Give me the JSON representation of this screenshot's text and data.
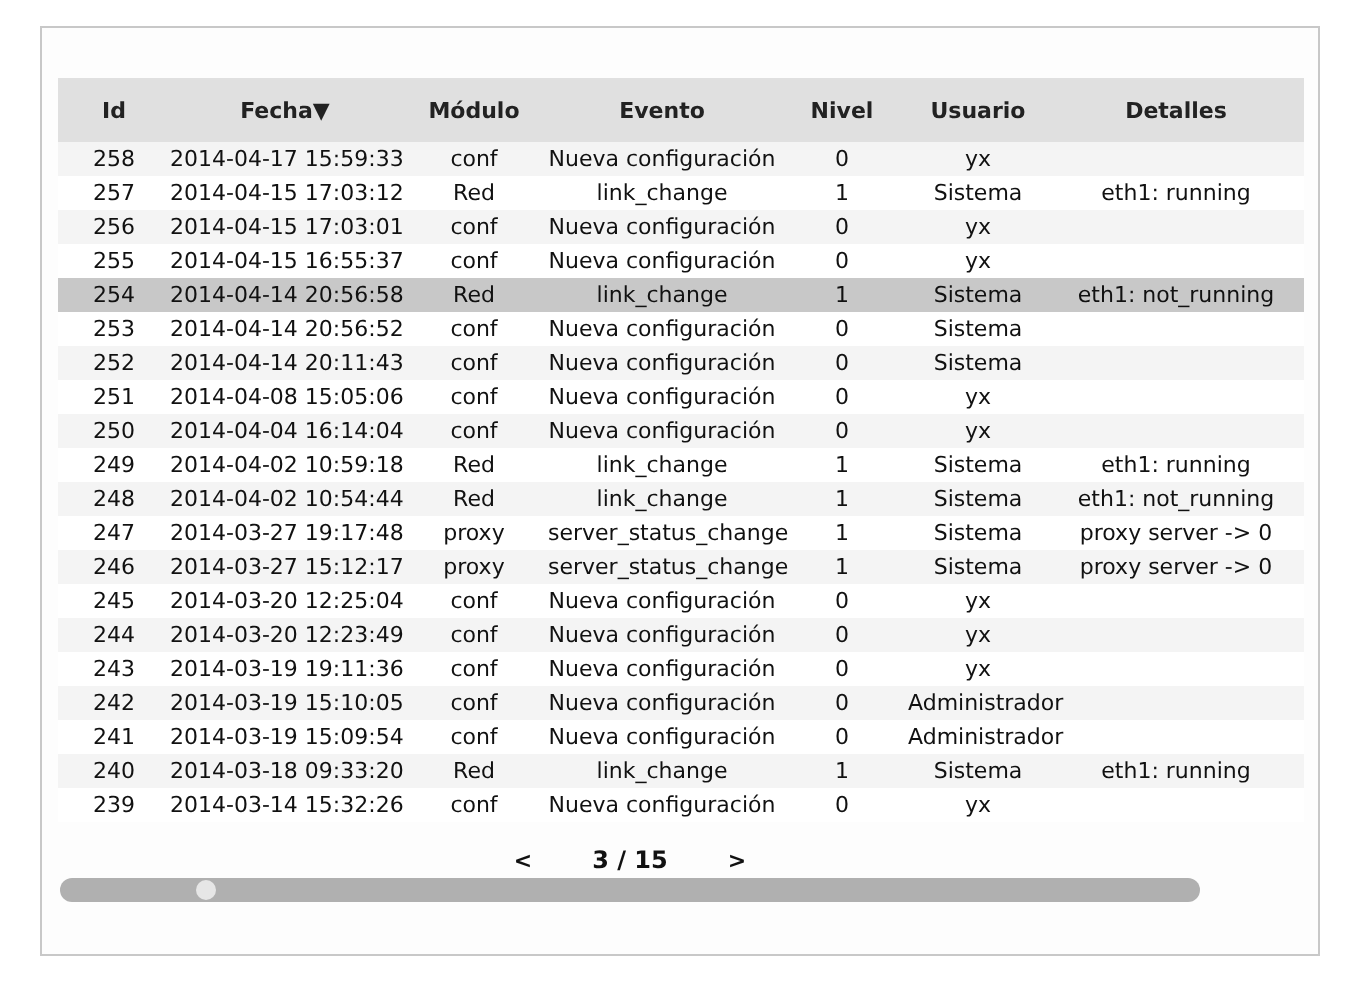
{
  "table": {
    "columns": [
      {
        "label": "Id"
      },
      {
        "label": "Fecha▼"
      },
      {
        "label": "Módulo"
      },
      {
        "label": "Evento"
      },
      {
        "label": "Nivel"
      },
      {
        "label": "Usuario"
      },
      {
        "label": "Detalles"
      }
    ],
    "rows": [
      {
        "selected": false,
        "cells": [
          "258",
          "2014-04-17 15:59:33",
          "conf",
          "Nueva configuración",
          "0",
          "yx",
          ""
        ]
      },
      {
        "selected": false,
        "cells": [
          "257",
          "2014-04-15 17:03:12",
          "Red",
          "link_change",
          "1",
          "Sistema",
          "eth1: running"
        ]
      },
      {
        "selected": false,
        "cells": [
          "256",
          "2014-04-15 17:03:01",
          "conf",
          "Nueva configuración",
          "0",
          "yx",
          ""
        ]
      },
      {
        "selected": false,
        "cells": [
          "255",
          "2014-04-15 16:55:37",
          "conf",
          "Nueva configuración",
          "0",
          "yx",
          ""
        ]
      },
      {
        "selected": true,
        "cells": [
          "254",
          "2014-04-14 20:56:58",
          "Red",
          "link_change",
          "1",
          "Sistema",
          "eth1: not_running"
        ]
      },
      {
        "selected": false,
        "cells": [
          "253",
          "2014-04-14 20:56:52",
          "conf",
          "Nueva configuración",
          "0",
          "Sistema",
          ""
        ]
      },
      {
        "selected": false,
        "cells": [
          "252",
          "2014-04-14 20:11:43",
          "conf",
          "Nueva configuración",
          "0",
          "Sistema",
          ""
        ]
      },
      {
        "selected": false,
        "cells": [
          "251",
          "2014-04-08 15:05:06",
          "conf",
          "Nueva configuración",
          "0",
          "yx",
          ""
        ]
      },
      {
        "selected": false,
        "cells": [
          "250",
          "2014-04-04 16:14:04",
          "conf",
          "Nueva configuración",
          "0",
          "yx",
          ""
        ]
      },
      {
        "selected": false,
        "cells": [
          "249",
          "2014-04-02 10:59:18",
          "Red",
          "link_change",
          "1",
          "Sistema",
          "eth1: running"
        ]
      },
      {
        "selected": false,
        "cells": [
          "248",
          "2014-04-02 10:54:44",
          "Red",
          "link_change",
          "1",
          "Sistema",
          "eth1: not_running"
        ]
      },
      {
        "selected": false,
        "cells": [
          "247",
          "2014-03-27 19:17:48",
          "proxy",
          "server_status_change",
          "1",
          "Sistema",
          "proxy server -> 0"
        ]
      },
      {
        "selected": false,
        "cells": [
          "246",
          "2014-03-27 15:12:17",
          "proxy",
          "server_status_change",
          "1",
          "Sistema",
          "proxy server -> 0"
        ]
      },
      {
        "selected": false,
        "cells": [
          "245",
          "2014-03-20 12:25:04",
          "conf",
          "Nueva configuración",
          "0",
          "yx",
          ""
        ]
      },
      {
        "selected": false,
        "cells": [
          "244",
          "2014-03-20 12:23:49",
          "conf",
          "Nueva configuración",
          "0",
          "yx",
          ""
        ]
      },
      {
        "selected": false,
        "cells": [
          "243",
          "2014-03-19 19:11:36",
          "conf",
          "Nueva configuración",
          "0",
          "yx",
          ""
        ]
      },
      {
        "selected": false,
        "cells": [
          "242",
          "2014-03-19 15:10:05",
          "conf",
          "Nueva configuración",
          "0",
          "Administrador",
          ""
        ]
      },
      {
        "selected": false,
        "cells": [
          "241",
          "2014-03-19 15:09:54",
          "conf",
          "Nueva configuración",
          "0",
          "Administrador",
          ""
        ]
      },
      {
        "selected": false,
        "cells": [
          "240",
          "2014-03-18 09:33:20",
          "Red",
          "link_change",
          "1",
          "Sistema",
          "eth1: running"
        ]
      },
      {
        "selected": false,
        "cells": [
          "239",
          "2014-03-14 15:32:26",
          "conf",
          "Nueva configuración",
          "0",
          "yx",
          ""
        ]
      }
    ]
  },
  "pagination": {
    "prev": "<",
    "page": "3 / 15",
    "next": ">"
  },
  "slider": {
    "level": 0.13
  }
}
